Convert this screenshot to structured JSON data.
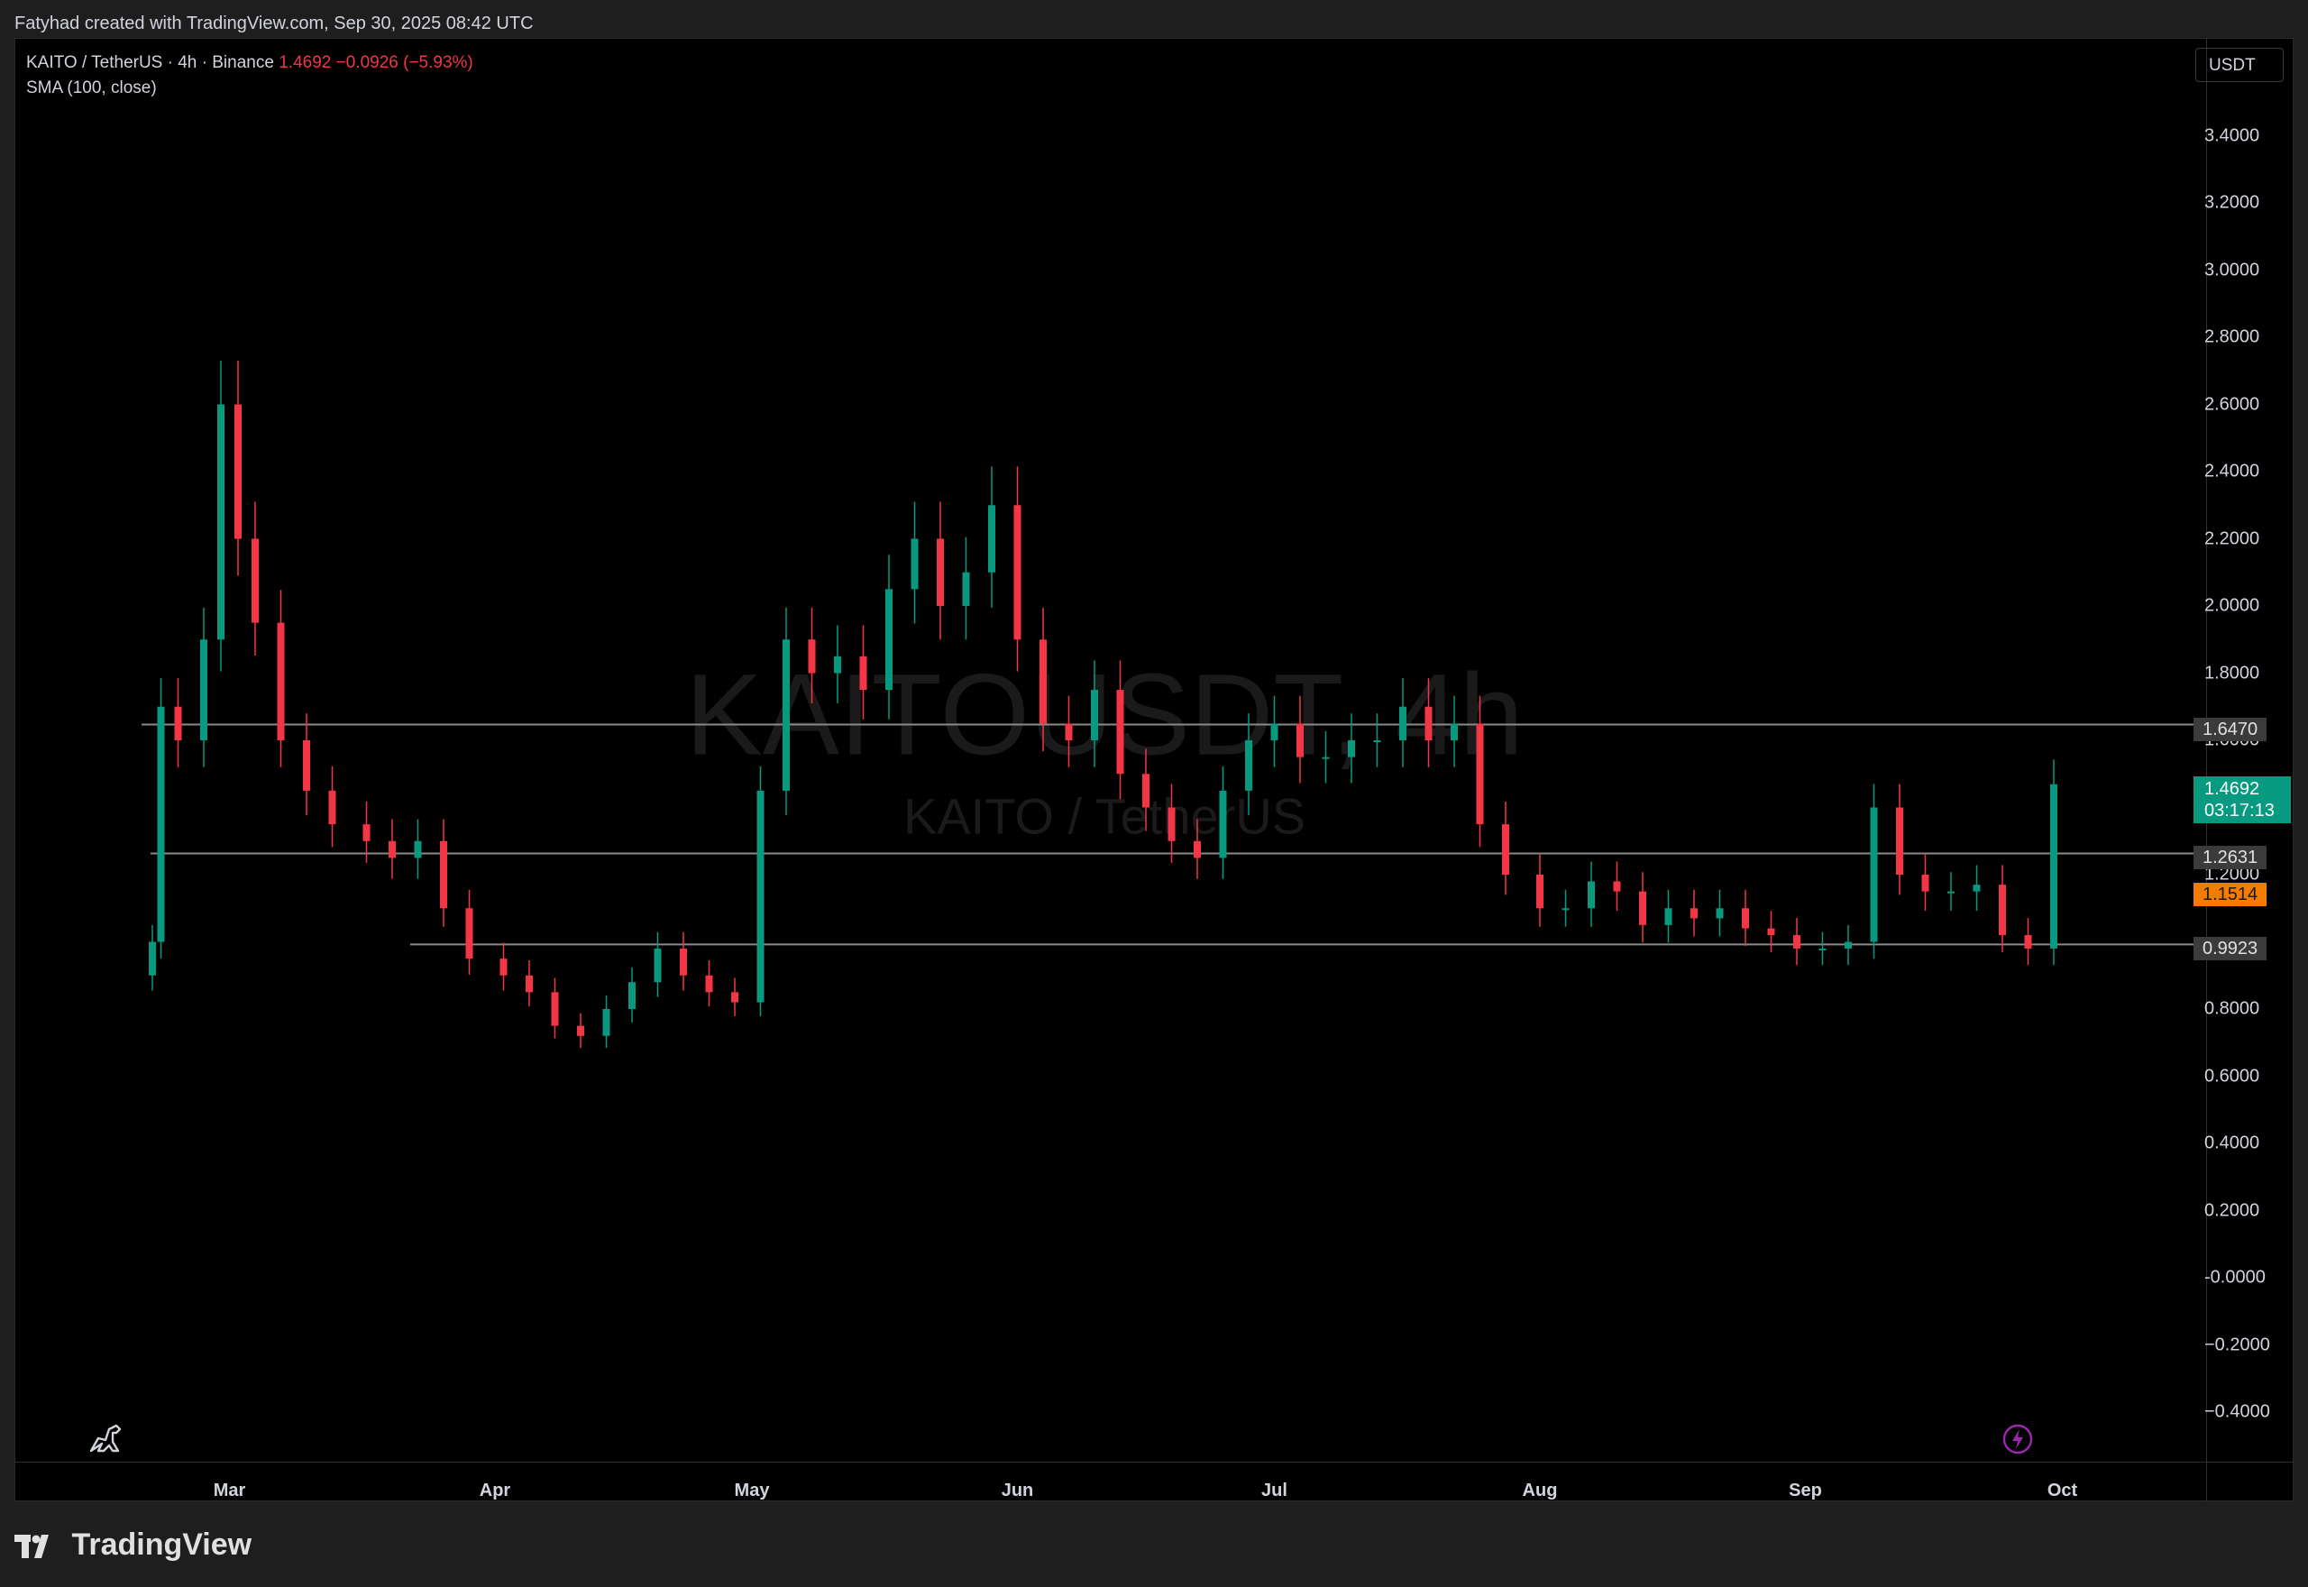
{
  "header": {
    "credit": "Fatyhad created with TradingView.com, Sep 30, 2025 08:42 UTC"
  },
  "legend": {
    "symbol": "KAITO / TetherUS · 4h · Binance",
    "price": "1.4692",
    "change": "−0.0926 (−5.93%)",
    "indicator": "SMA (100, close)"
  },
  "currency": "USDT",
  "watermark": {
    "main": "KAITOUSDT, 4h",
    "sub": "KAITO / TetherUS"
  },
  "tags": {
    "level_high": "1.6470",
    "price": "1.4692",
    "countdown": "03:17:13",
    "level_mid": "1.2631",
    "sma": "1.1514",
    "level_low": "0.9923"
  },
  "brand": "TradingView",
  "colors": {
    "up": "#089981",
    "down": "#f23645",
    "sma": "#f57c00",
    "background": "#000000",
    "level_line": "#8a8a8a"
  },
  "icons": {
    "bottom_left": "dinosaur-icon",
    "bottom_right": "lightning-icon"
  },
  "chart_data": {
    "type": "candlestick",
    "title": "KAITO / TetherUS · 4h · Binance",
    "y_axis": {
      "ticks": [
        "3.4000",
        "3.2000",
        "3.0000",
        "2.8000",
        "2.6000",
        "2.4000",
        "2.2000",
        "2.0000",
        "1.8000",
        "1.6000",
        "1.2000",
        "0.8000",
        "0.6000",
        "0.4000",
        "0.2000",
        "-0.0000",
        "−0.2000",
        "−0.4000"
      ],
      "range": [
        -0.5,
        3.55
      ]
    },
    "x_axis": {
      "ticks": [
        "Mar",
        "Apr",
        "May",
        "Jun",
        "Jul",
        "Aug",
        "Sep",
        "Oct"
      ]
    },
    "horizontal_levels": [
      1.647,
      1.2631,
      0.9923
    ],
    "series": [
      {
        "name": "KAITO / TetherUS",
        "dates": [
          "Feb 20",
          "Feb 21",
          "Feb 23",
          "Feb 26",
          "Feb 28",
          "Mar 2",
          "Mar 4",
          "Mar 7",
          "Mar 10",
          "Mar 13",
          "Mar 17",
          "Mar 20",
          "Mar 23",
          "Mar 26",
          "Mar 29",
          "Apr 2",
          "Apr 5",
          "Apr 8",
          "Apr 11",
          "Apr 14",
          "Apr 17",
          "Apr 20",
          "Apr 23",
          "Apr 26",
          "Apr 29",
          "May 2",
          "May 5",
          "May 8",
          "May 11",
          "May 14",
          "May 17",
          "May 20",
          "May 23",
          "May 26",
          "May 29",
          "Jun 1",
          "Jun 4",
          "Jun 7",
          "Jun 10",
          "Jun 13",
          "Jun 16",
          "Jun 19",
          "Jun 22",
          "Jun 25",
          "Jun 28",
          "Jul 1",
          "Jul 4",
          "Jul 7",
          "Jul 10",
          "Jul 13",
          "Jul 16",
          "Jul 19",
          "Jul 22",
          "Jul 25",
          "Jul 28",
          "Aug 1",
          "Aug 4",
          "Aug 7",
          "Aug 10",
          "Aug 13",
          "Aug 16",
          "Aug 19",
          "Aug 22",
          "Aug 25",
          "Aug 28",
          "Aug 31",
          "Sep 3",
          "Sep 6",
          "Sep 9",
          "Sep 12",
          "Sep 15",
          "Sep 18",
          "Sep 21",
          "Sep 24",
          "Sep 27",
          "Sep 30"
        ],
        "close": [
          1.0,
          1.7,
          1.6,
          1.9,
          2.6,
          2.2,
          1.95,
          1.6,
          1.45,
          1.35,
          1.3,
          1.25,
          1.3,
          1.1,
          0.95,
          0.9,
          0.85,
          0.75,
          0.72,
          0.8,
          0.88,
          0.98,
          0.9,
          0.85,
          0.82,
          1.45,
          1.9,
          1.8,
          1.85,
          1.75,
          2.05,
          2.2,
          2.0,
          2.1,
          2.3,
          1.9,
          1.65,
          1.6,
          1.75,
          1.5,
          1.4,
          1.3,
          1.25,
          1.45,
          1.6,
          1.65,
          1.55,
          1.55,
          1.6,
          1.6,
          1.7,
          1.6,
          1.65,
          1.35,
          1.2,
          1.1,
          1.1,
          1.18,
          1.15,
          1.05,
          1.1,
          1.07,
          1.1,
          1.04,
          1.02,
          0.98,
          0.98,
          1.0,
          1.4,
          1.2,
          1.15,
          1.15,
          1.17,
          1.02,
          0.98,
          1.4692
        ]
      },
      {
        "name": "SMA (100, close)",
        "last": 1.1514
      }
    ]
  }
}
